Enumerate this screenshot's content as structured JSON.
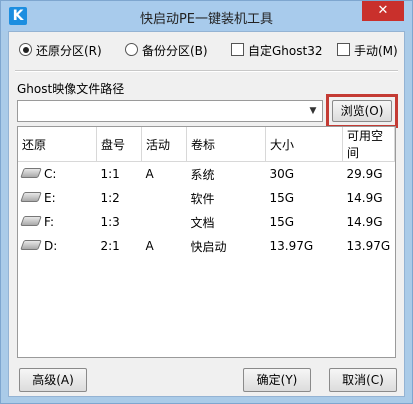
{
  "window": {
    "title": "快启动PE一键装机工具",
    "app_icon": "K",
    "close_label": "✕"
  },
  "options": {
    "restore": "还原分区(R)",
    "backup": "备份分区(B)",
    "custom_ghost": "自定Ghost32",
    "manual": "手动(M)",
    "restore_selected": true
  },
  "path": {
    "label": "Ghost映像文件路径",
    "value": "",
    "browse": "浏览(O)"
  },
  "table": {
    "headers": [
      "还原",
      "盘号",
      "活动",
      "卷标",
      "大小",
      "可用空间"
    ],
    "rows": [
      [
        "C:",
        "1:1",
        "A",
        "系统",
        "30G",
        "29.9G"
      ],
      [
        "E:",
        "1:2",
        "",
        "软件",
        "15G",
        "14.9G"
      ],
      [
        "F:",
        "1:3",
        "",
        "文档",
        "15G",
        "14.9G"
      ],
      [
        "D:",
        "2:1",
        "A",
        "快启动",
        "13.97G",
        "13.97G"
      ]
    ]
  },
  "buttons": {
    "advanced": "高级(A)",
    "ok": "确定(Y)",
    "cancel": "取消(C)"
  },
  "icons": {
    "app": "app-logo-icon",
    "drive": "drive-icon",
    "dropdown": "chevron-down-icon"
  }
}
